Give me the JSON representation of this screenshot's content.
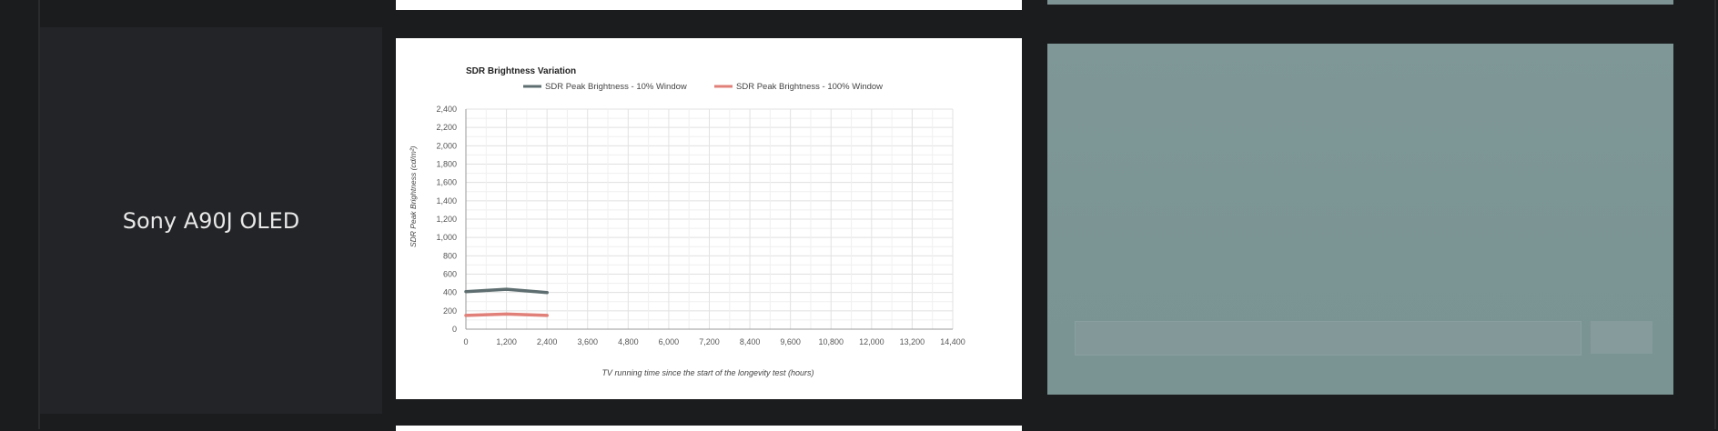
{
  "row": {
    "tv_name": "Sony A90J OLED"
  },
  "colors": {
    "page_bg": "#1b1c1e",
    "cell_bg": "#232427",
    "series_10": "#5e6e70",
    "series_100": "#e08078",
    "photo_bg": "#7e9595"
  },
  "chart_data": {
    "type": "line",
    "title": "SDR Brightness Variation",
    "xlabel": "TV running time since the start of the longevity test (hours)",
    "ylabel": "SDR Peak Brightness (cd/m²)",
    "xlim": [
      0,
      14400
    ],
    "ylim": [
      0,
      2400
    ],
    "x_ticks": [
      "0",
      "1,200",
      "2,400",
      "3,600",
      "4,800",
      "6,000",
      "7,200",
      "8,400",
      "9,600",
      "10,800",
      "12,000",
      "13,200",
      "14,400"
    ],
    "y_ticks": [
      "0",
      "200",
      "400",
      "600",
      "800",
      "1,000",
      "1,200",
      "1,400",
      "1,600",
      "1,800",
      "2,000",
      "2,200",
      "2,400"
    ],
    "grid": true,
    "legend_position": "top",
    "series": [
      {
        "name": "SDR Peak Brightness - 10% Window",
        "color": "#5e6e70",
        "x": [
          0,
          1200,
          2400
        ],
        "y": [
          410,
          435,
          400
        ]
      },
      {
        "name": "SDR Peak Brightness - 100% Window",
        "color": "#e08078",
        "x": [
          0,
          1200,
          2400
        ],
        "y": [
          150,
          165,
          150
        ]
      }
    ]
  }
}
